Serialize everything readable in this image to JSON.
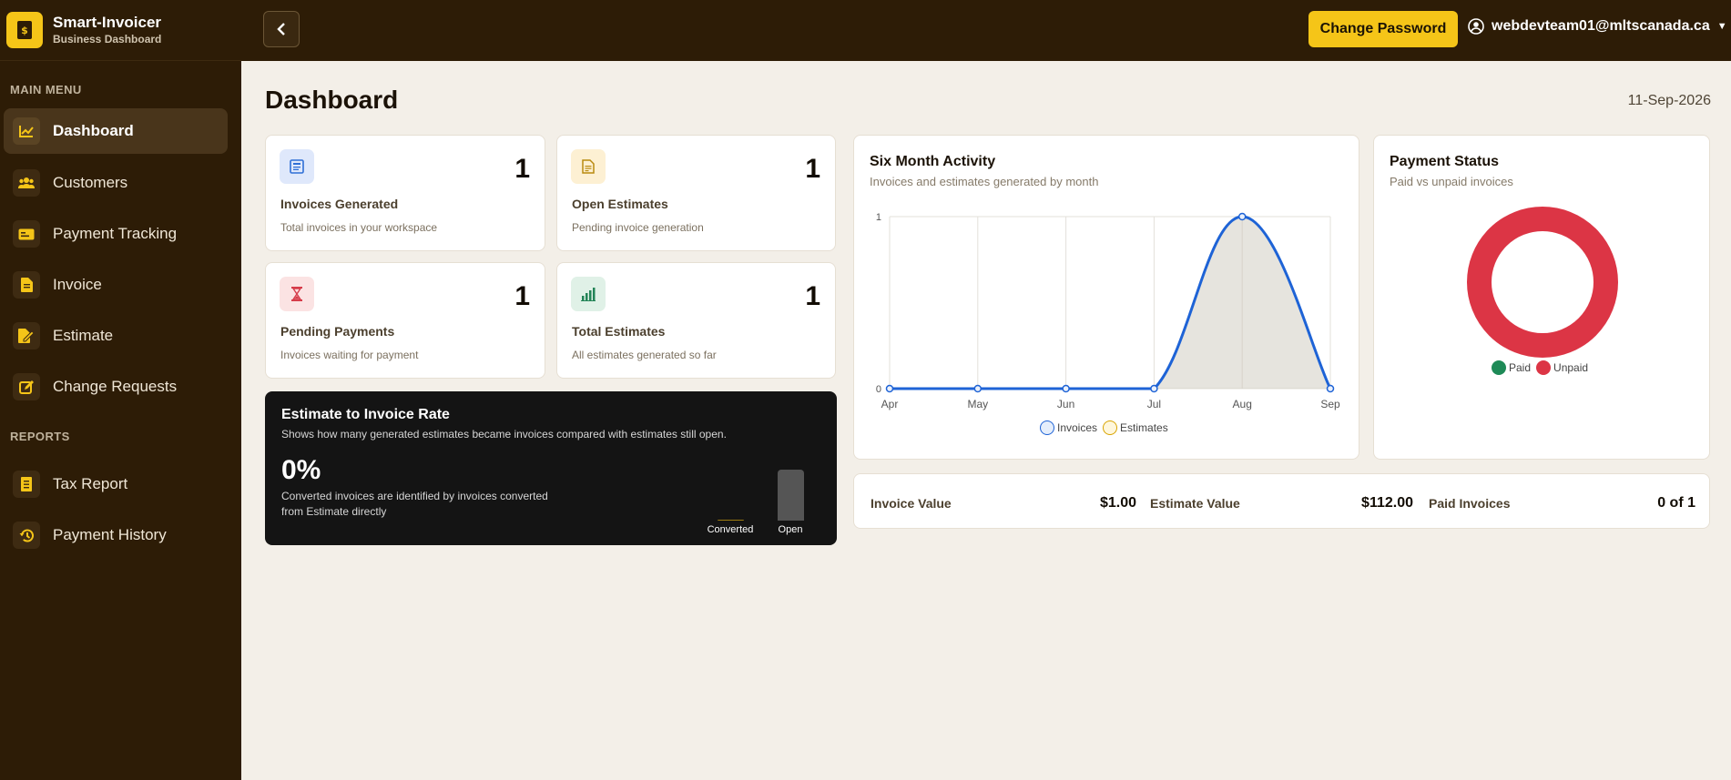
{
  "brand": {
    "title": "Smart-Invoicer",
    "subtitle": "Business Dashboard"
  },
  "sidebar": {
    "main_menu_label": "MAIN MENU",
    "reports_label": "REPORTS",
    "items": [
      {
        "label": "Dashboard",
        "icon": "chart-line-icon",
        "active": true
      },
      {
        "label": "Customers",
        "icon": "users-icon"
      },
      {
        "label": "Payment Tracking",
        "icon": "id-card-icon"
      },
      {
        "label": "Invoice",
        "icon": "file-invoice-icon"
      },
      {
        "label": "Estimate",
        "icon": "file-signature-icon"
      },
      {
        "label": "Change Requests",
        "icon": "edit-icon"
      }
    ],
    "report_items": [
      {
        "label": "Tax Report",
        "icon": "receipt-icon"
      },
      {
        "label": "Payment History",
        "icon": "history-icon"
      }
    ]
  },
  "topbar": {
    "change_password_label": "Change Password",
    "user_email": "webdevteam01@mltscanada.ca"
  },
  "page": {
    "title": "Dashboard",
    "date": "11-Sep-2026"
  },
  "stats": [
    {
      "title": "Invoices Generated",
      "subtitle": "Total invoices in your workspace",
      "value": "1",
      "icon": "invoice-icon",
      "color": "#dfe8fb"
    },
    {
      "title": "Open Estimates",
      "subtitle": "Pending invoice generation",
      "value": "1",
      "icon": "document-icon",
      "color": "#fdf0d3"
    },
    {
      "title": "Pending Payments",
      "subtitle": "Invoices waiting for payment",
      "value": "1",
      "icon": "hourglass-icon",
      "color": "#fbe3e3"
    },
    {
      "title": "Total Estimates",
      "subtitle": "All estimates generated so far",
      "value": "1",
      "icon": "bar-chart-icon",
      "color": "#e0f1e7"
    }
  ],
  "rate": {
    "title": "Estimate to Invoice Rate",
    "subtitle": "Shows how many generated estimates became invoices compared with estimates still open.",
    "value": "0%",
    "description": "Converted invoices are identified by invoices converted from Estimate directly",
    "bars": [
      {
        "label": "Converted",
        "fraction": 0
      },
      {
        "label": "Open",
        "fraction": 1
      }
    ]
  },
  "activity": {
    "title": "Six Month Activity",
    "subtitle": "Invoices and estimates generated by month"
  },
  "payment_status": {
    "title": "Payment Status",
    "subtitle": "Paid vs unpaid invoices"
  },
  "chart_data": [
    {
      "type": "area",
      "categories": [
        "Apr",
        "May",
        "Jun",
        "Jul",
        "Aug",
        "Sep"
      ],
      "series": [
        {
          "name": "Invoices",
          "values": [
            0,
            0,
            0,
            0,
            1,
            0
          ],
          "color": "#1e63d6"
        },
        {
          "name": "Estimates",
          "values": [
            0,
            0,
            0,
            0,
            1,
            0
          ],
          "color": "#d9a400"
        }
      ],
      "ylim": [
        0,
        1
      ],
      "yticks": [
        "0",
        "1"
      ],
      "grid": true,
      "legend": "bottom"
    },
    {
      "type": "pie",
      "donut": true,
      "categories": [
        "Paid",
        "Unpaid"
      ],
      "values": [
        0,
        1
      ],
      "colors": [
        "#1e8a57",
        "#dc3545"
      ],
      "legend": "bottom"
    }
  ],
  "summary": [
    {
      "label": "Invoice Value",
      "value": "$1.00"
    },
    {
      "label": "Estimate Value",
      "value": "$112.00"
    },
    {
      "label": "Paid Invoices",
      "value": "0 of 1"
    }
  ]
}
